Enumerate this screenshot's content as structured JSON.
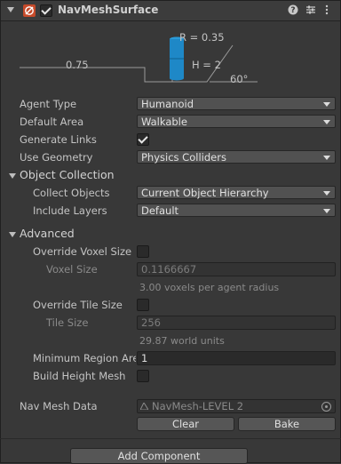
{
  "component": {
    "title": "NavMeshSurface",
    "enabled": true,
    "help_icon": "help-icon",
    "preset_icon": "preset-icon",
    "menu_icon": "kebab-menu-icon"
  },
  "agent_diagram": {
    "radius_label": "R = 0.35",
    "height_label": "H = 2",
    "step_label": "0.75",
    "slope_label": "60°",
    "agent_color": "#1e88c7"
  },
  "fields": {
    "agent_type": {
      "label": "Agent Type",
      "value": "Humanoid"
    },
    "default_area": {
      "label": "Default Area",
      "value": "Walkable"
    },
    "generate_links": {
      "label": "Generate Links",
      "checked": true
    },
    "use_geometry": {
      "label": "Use Geometry",
      "value": "Physics Colliders"
    }
  },
  "object_collection": {
    "title": "Object Collection",
    "collect_objects": {
      "label": "Collect Objects",
      "value": "Current Object Hierarchy"
    },
    "include_layers": {
      "label": "Include Layers",
      "value": "Default"
    }
  },
  "advanced": {
    "title": "Advanced",
    "override_voxel_size": {
      "label": "Override Voxel Size",
      "checked": false
    },
    "voxel_size": {
      "label": "Voxel Size",
      "value": "0.1166667",
      "hint": "3.00 voxels per agent radius"
    },
    "override_tile_size": {
      "label": "Override Tile Size",
      "checked": false
    },
    "tile_size": {
      "label": "Tile Size",
      "value": "256",
      "hint": "29.87 world units"
    },
    "min_region_area": {
      "label": "Minimum Region Area",
      "value": "1"
    },
    "build_height_mesh": {
      "label": "Build Height Mesh",
      "checked": false
    }
  },
  "nav_mesh_data": {
    "label": "Nav Mesh Data",
    "value": "NavMesh-LEVEL 2"
  },
  "buttons": {
    "clear": "Clear",
    "bake": "Bake",
    "add_component": "Add Component"
  }
}
